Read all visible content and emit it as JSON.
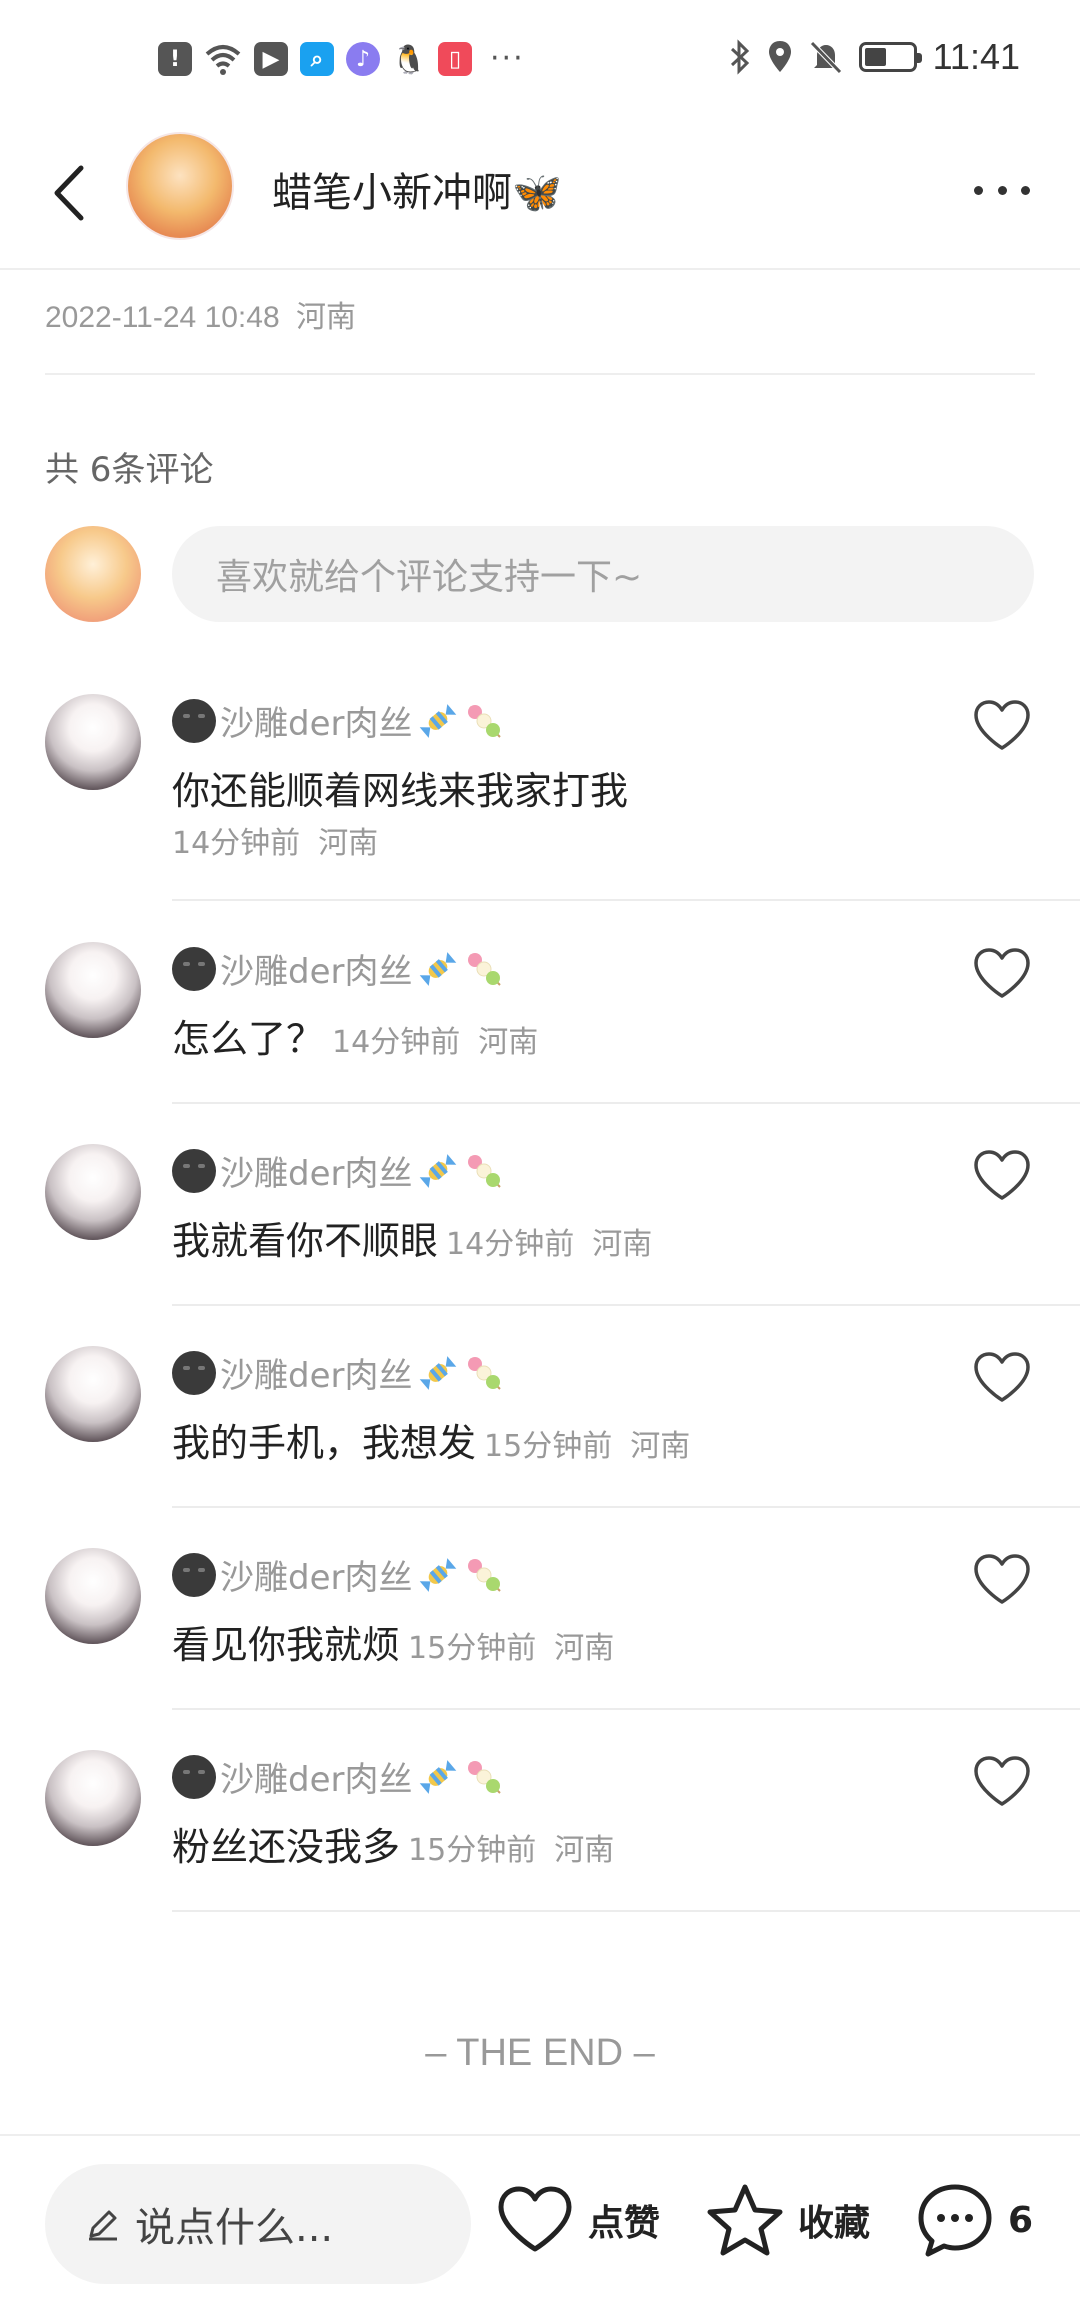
{
  "status_bar": {
    "time": "11:41",
    "battery_level": 0.45,
    "left_icons": [
      "alert-icon",
      "wifi-icon",
      "app-icon",
      "search-app-icon",
      "music-app-icon",
      "qq-icon",
      "book-app-icon"
    ],
    "right_icons": [
      "bluetooth-icon",
      "location-icon",
      "mute-icon",
      "battery-icon"
    ]
  },
  "header": {
    "author_name": "蜡笔小新冲啊🦋"
  },
  "post": {
    "date": "2022-11-24 10:48",
    "location": "河南"
  },
  "comments_section": {
    "count_label": "共 6条评论",
    "input_placeholder": "喜欢就给个评论支持一下~",
    "comments": [
      {
        "user": "沙雕der肉丝",
        "text": "你还能顺着网线来我家打我",
        "time": "14分钟前",
        "location": "河南"
      },
      {
        "user": "沙雕der肉丝",
        "text": "怎么了？",
        "time": "14分钟前",
        "location": "河南"
      },
      {
        "user": "沙雕der肉丝",
        "text": "我就看你不顺眼",
        "time": "14分钟前",
        "location": "河南"
      },
      {
        "user": "沙雕der肉丝",
        "text": "我的手机，我想发",
        "time": "15分钟前",
        "location": "河南"
      },
      {
        "user": "沙雕der肉丝",
        "text": "看见你我就烦",
        "time": "15分钟前",
        "location": "河南"
      },
      {
        "user": "沙雕der肉丝",
        "text": "粉丝还没我多",
        "time": "15分钟前",
        "location": "河南"
      }
    ],
    "end_label": "– THE END –"
  },
  "bottom_bar": {
    "say_placeholder": "说点什么...",
    "like_label": "点赞",
    "collect_label": "收藏",
    "comment_count": "6"
  }
}
